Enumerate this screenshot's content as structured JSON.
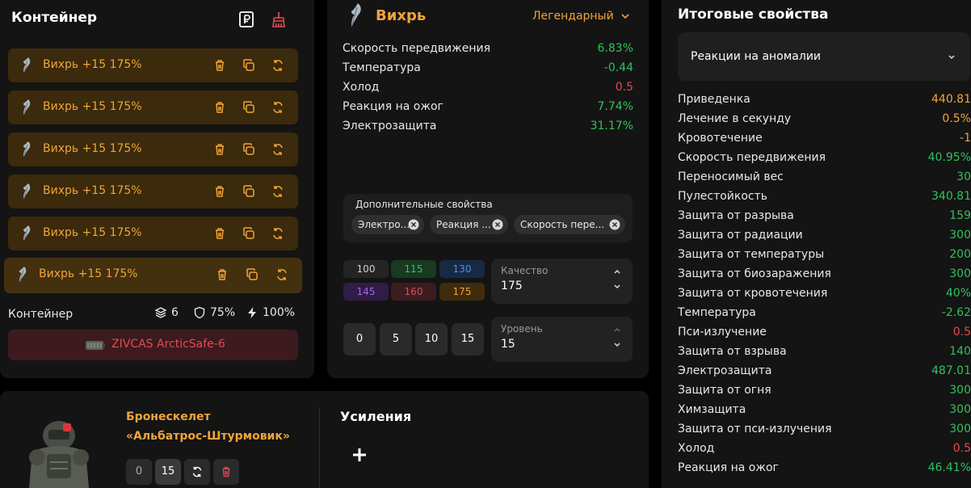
{
  "container": {
    "title": "Контейнер",
    "items": [
      {
        "label": "Вихрь  +15  175%"
      },
      {
        "label": "Вихрь  +15  175%"
      },
      {
        "label": "Вихрь  +15  175%"
      },
      {
        "label": "Вихрь  +15  175%"
      },
      {
        "label": "Вихрь  +15  175%"
      },
      {
        "label": "Вихрь  +15  175%"
      }
    ],
    "stats_label": "Контейнер",
    "slots": "6",
    "protection": "75%",
    "efficiency": "100%",
    "device_name": "ZIVCAS ArcticSafe-6"
  },
  "artifact": {
    "name": "Вихрь",
    "rarity": "Легендарный",
    "properties": [
      {
        "label": "Скорость передвижения",
        "value": "6.83%"
      },
      {
        "label": "Температура",
        "value": "-0.44"
      },
      {
        "label": "Холод",
        "value": "0.5"
      },
      {
        "label": "Реакция на ожог",
        "value": "7.74%"
      },
      {
        "label": "Электрозащита",
        "value": "31.17%"
      }
    ],
    "extra_title": "Дополнительные свойства",
    "extra_chips": [
      "Электро...",
      "Реакция ...",
      "Скорость пере..."
    ],
    "quality_buttons": [
      "100",
      "115",
      "130",
      "145",
      "160",
      "175"
    ],
    "quality_label": "Качество",
    "quality_value": "175",
    "level_buttons": [
      "0",
      "5",
      "10",
      "15"
    ],
    "level_label": "Уровень",
    "level_value": "15"
  },
  "summary": {
    "title": "Итоговые свойства",
    "filter": "Реакции на аномалии",
    "rows": [
      {
        "label": "Приведенка",
        "value": "440.81"
      },
      {
        "label": "Лечение в секунду",
        "value": "0.5%"
      },
      {
        "label": "Кровотечение",
        "value": "-1"
      },
      {
        "label": "Скорость передвижения",
        "value": "40.95%"
      },
      {
        "label": "Переносимый вес",
        "value": "30"
      },
      {
        "label": "Пулестойкость",
        "value": "340.81"
      },
      {
        "label": "Защита от разрыва",
        "value": "159"
      },
      {
        "label": "Защита от радиации",
        "value": "300"
      },
      {
        "label": "Защита от температуры",
        "value": "200"
      },
      {
        "label": "Защита от биозаражения",
        "value": "300"
      },
      {
        "label": "Защита от кровотечения",
        "value": "40%"
      },
      {
        "label": "Температура",
        "value": "-2.62"
      },
      {
        "label": "Пси-излучение",
        "value": "0.5"
      },
      {
        "label": "Защита от взрыва",
        "value": "140"
      },
      {
        "label": "Электрозащита",
        "value": "487.01"
      },
      {
        "label": "Защита от огня",
        "value": "300"
      },
      {
        "label": "Химзащита",
        "value": "300"
      },
      {
        "label": "Защита от пси-излучения",
        "value": "300"
      },
      {
        "label": "Холод",
        "value": "0.5"
      },
      {
        "label": "Реакция на ожог",
        "value": "46.41%"
      }
    ]
  },
  "exoskeleton": {
    "name_line1": "Бронескелет",
    "name_line2": "«Альбатрос-Штурмовик»",
    "level_buttons": [
      "0",
      "15"
    ],
    "boost_title": "Усиления"
  },
  "colors": {
    "accent": "#f0a43a",
    "positive": "#2fc25b",
    "negative": "#e5484d"
  }
}
